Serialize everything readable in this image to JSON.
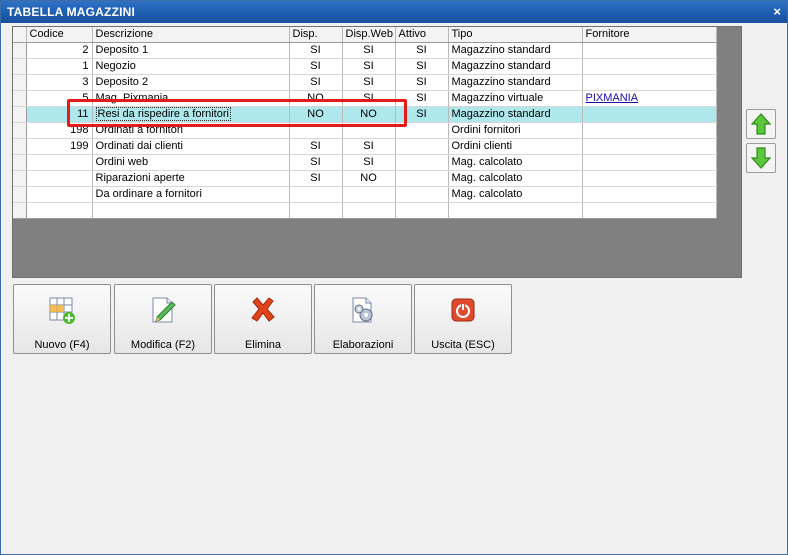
{
  "window": {
    "title": "TABELLA MAGAZZINI",
    "close_glyph": "×"
  },
  "grid": {
    "columns": [
      "Codice",
      "Descrizione",
      "Disp.",
      "Disp.Web",
      "Attivo",
      "Tipo",
      "Fornitore"
    ],
    "rows": [
      {
        "codice": "2",
        "descrizione": "Deposito 1",
        "disp": "SI",
        "dispweb": "SI",
        "attivo": "SI",
        "tipo": "Magazzino standard",
        "fornitore": ""
      },
      {
        "codice": "1",
        "descrizione": "Negozio",
        "disp": "SI",
        "dispweb": "SI",
        "attivo": "SI",
        "tipo": "Magazzino standard",
        "fornitore": ""
      },
      {
        "codice": "3",
        "descrizione": "Deposito 2",
        "disp": "SI",
        "dispweb": "SI",
        "attivo": "SI",
        "tipo": "Magazzino standard",
        "fornitore": ""
      },
      {
        "codice": "5",
        "descrizione": "Mag. Pixmania",
        "disp": "NO",
        "dispweb": "SI",
        "attivo": "SI",
        "tipo": "Magazzino virtuale",
        "fornitore": "PIXMANIA"
      },
      {
        "codice": "11",
        "descrizione": "Resi da rispedire a fornitori",
        "disp": "NO",
        "dispweb": "NO",
        "attivo": "SI",
        "tipo": "Magazzino standard",
        "fornitore": ""
      },
      {
        "codice": "198",
        "descrizione": "Ordinati a fornitori",
        "disp": "",
        "dispweb": "",
        "attivo": "",
        "tipo": "Ordini fornitori",
        "fornitore": ""
      },
      {
        "codice": "199",
        "descrizione": "Ordinati dai clienti",
        "disp": "SI",
        "dispweb": "SI",
        "attivo": "",
        "tipo": "Ordini clienti",
        "fornitore": ""
      },
      {
        "codice": "",
        "descrizione": "Ordini web",
        "disp": "SI",
        "dispweb": "SI",
        "attivo": "",
        "tipo": "Mag. calcolato",
        "fornitore": ""
      },
      {
        "codice": "",
        "descrizione": "Riparazioni aperte",
        "disp": "SI",
        "dispweb": "NO",
        "attivo": "",
        "tipo": "Mag. calcolato",
        "fornitore": ""
      },
      {
        "codice": "",
        "descrizione": "Da ordinare a fornitori",
        "disp": "",
        "dispweb": "",
        "attivo": "",
        "tipo": "Mag. calcolato",
        "fornitore": ""
      },
      {
        "codice": "",
        "descrizione": "",
        "disp": "",
        "dispweb": "",
        "attivo": "",
        "tipo": "",
        "fornitore": ""
      }
    ]
  },
  "toolbar": {
    "nuovo": "Nuovo (F4)",
    "modifica": "Modifica (F2)",
    "elimina": "Elimina",
    "elaborazioni": "Elaborazioni",
    "uscita": "Uscita (ESC)"
  },
  "colors": {
    "selected_row": "#aee8ec",
    "highlight_box": "#e21b1b",
    "title_bar": "#1d5db0"
  }
}
